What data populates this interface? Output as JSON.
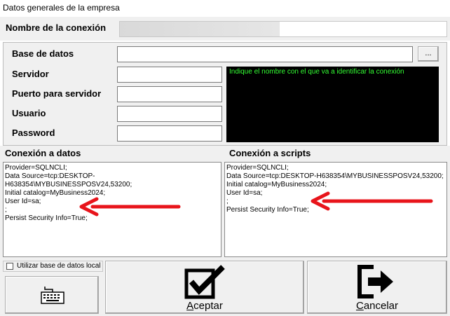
{
  "window": {
    "title": "Datos generales de la empresa"
  },
  "connection_name": {
    "label": "Nombre de la conexión",
    "value": ""
  },
  "fields": {
    "database_label": "Base de datos",
    "database_value": "",
    "browse_label": "...",
    "server_label": "Servidor",
    "server_value": "",
    "port_label": "Puerto para servidor",
    "port_value": "",
    "user_label": "Usuario",
    "user_value": "",
    "password_label": "Password",
    "password_value": ""
  },
  "hint_text": "Indique el nombre con el que va a identificar la conexión",
  "data_connection": {
    "label": "Conexión a datos",
    "text": "Provider=SQLNCLI;\nData Source=tcp:DESKTOP-H638354\\MYBUSINESSPOSV24,53200;\nInitial catalog=MyBusiness2024;\nUser Id=sa;\n;\nPersist Security Info=True;"
  },
  "script_connection": {
    "label": "Conexión a scripts",
    "text": "Provider=SQLNCLI;\nData Source=tcp:DESKTOP-H638354\\MYBUSINESSPOSV24,53200;\nInitial catalog=MyBusiness2024;\nUser Id=sa;\n;\nPersist Security Info=True;"
  },
  "local_db_checkbox": {
    "label": "Utilizar base de datos local",
    "checked": false
  },
  "buttons": {
    "accept_first": "A",
    "accept_rest": "ceptar",
    "cancel_first": "C",
    "cancel_rest": "ancelar"
  },
  "colors": {
    "panel": "#f0f0f0",
    "hint_bg": "#000000",
    "hint_fg": "#33ff33",
    "arrow": "#e8141b"
  },
  "icons": [
    "keyboard-icon",
    "checkmark-icon",
    "exit-arrow-icon"
  ]
}
